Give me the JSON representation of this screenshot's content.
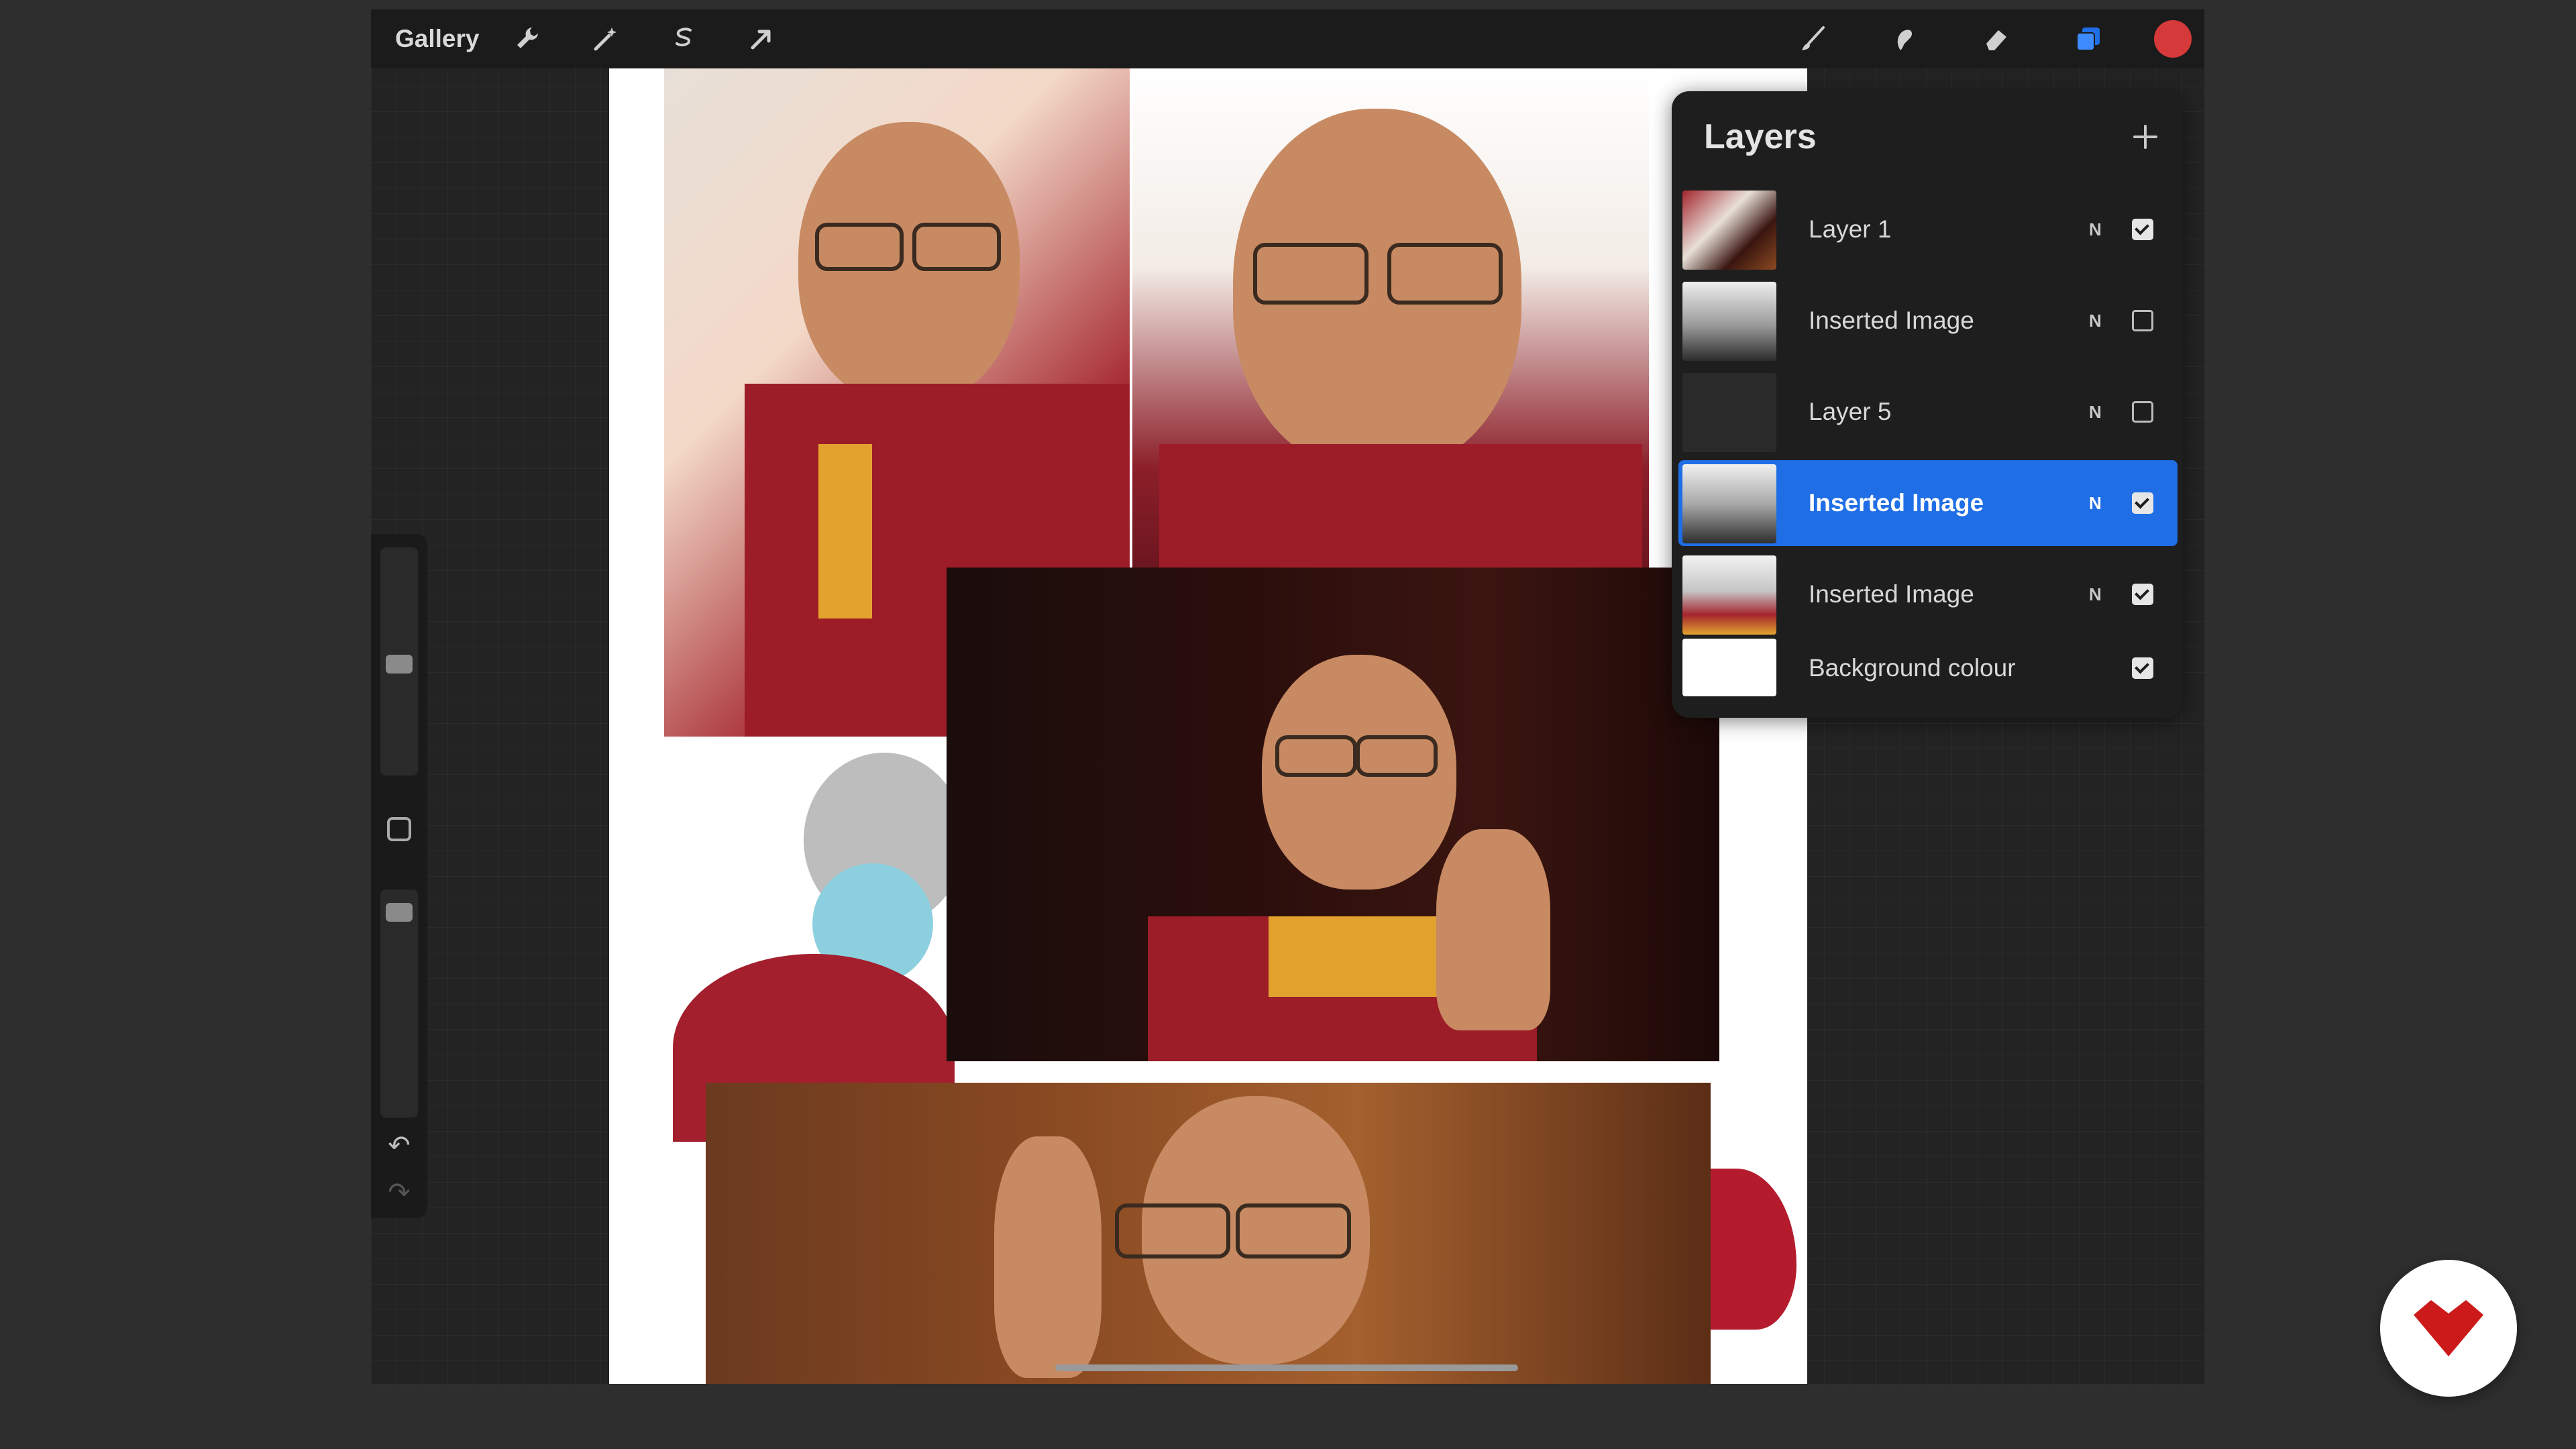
{
  "toolbar": {
    "gallery_label": "Gallery",
    "tools_left": [
      "wrench-icon",
      "magic-wand-icon",
      "selection-icon",
      "transform-arrow-icon"
    ],
    "tools_right": [
      "brush-icon",
      "smudge-icon",
      "eraser-icon",
      "layers-icon"
    ],
    "active_color": "#d6393a"
  },
  "layers_panel": {
    "title": "Layers",
    "layers": [
      {
        "name": "Layer 1",
        "mode": "N",
        "visible": true,
        "selected": false
      },
      {
        "name": "Inserted Image",
        "mode": "N",
        "visible": false,
        "selected": false
      },
      {
        "name": "Layer 5",
        "mode": "N",
        "visible": false,
        "selected": false
      },
      {
        "name": "Inserted Image",
        "mode": "N",
        "visible": true,
        "selected": true
      },
      {
        "name": "Inserted Image",
        "mode": "N",
        "visible": true,
        "selected": false
      },
      {
        "name": "Background colour",
        "mode": "",
        "visible": true,
        "selected": false
      }
    ]
  },
  "colors": {
    "selection_blue": "#1f6ee6",
    "brand_red": "#cc1a1a"
  }
}
